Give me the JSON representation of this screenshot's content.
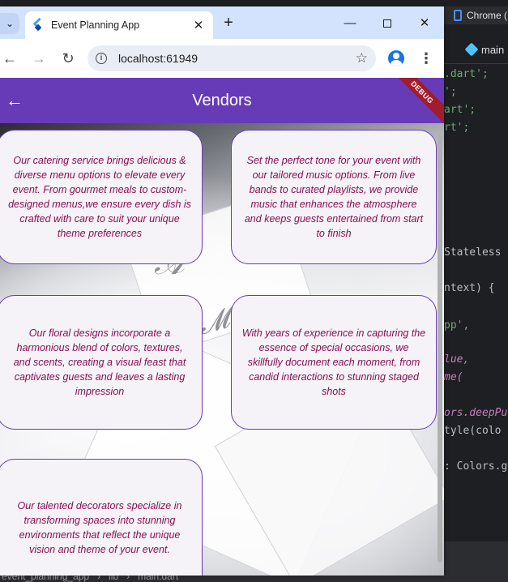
{
  "browser": {
    "tab_title": "Event Planning App",
    "tab_close": "✕",
    "new_tab": "+",
    "url": "localhost:61949",
    "tab_search_icon": "chevron-down-icon",
    "window_controls": {
      "minimize": "—",
      "close": "✕"
    },
    "nav": {
      "back": "←",
      "forward": "→",
      "reload": "↻"
    },
    "star": "☆",
    "menu": "⋮"
  },
  "app": {
    "title": "Vendors",
    "back_icon": "arrow-back-icon",
    "back_glyph": "←",
    "debug_banner": "DEBUG",
    "colors": {
      "app_bar": "#673ab7",
      "card_border": "#673ab7",
      "card_text": "#880e4f",
      "debug_banner": "#a11c2c"
    },
    "cards": [
      {
        "text": "Our catering service brings delicious & diverse menu options to elevate every event. From gourmet meals to custom-designed menus,we ensure every dish is crafted with care to suit your unique theme preferences"
      },
      {
        "text": "Set the perfect tone for your event with our tailored music options. From live bands to curated playlists, we provide music that enhances the atmosphere and keeps guests entertained from start to finish"
      },
      {
        "text": "Our floral designs incorporate a harmonious blend of colors, textures, and scents, creating a visual feast that captivates guests and leaves a lasting impression"
      },
      {
        "text": "With years of experience in capturing the essence of special occasions, we skillfully document each moment, from candid interactions to stunning staged shots"
      },
      {
        "text": "Our talented decorators specialize in transforming spaces into stunning environments that reflect the unique vision and theme of your event."
      }
    ]
  },
  "ide": {
    "chrome_tab": "Chrome (",
    "editor_tab": "main",
    "breadcrumb": [
      "event_planning_app",
      "lib",
      "main.dart"
    ],
    "code_lines": [
      ".dart';",
      "';",
      "art';",
      "rt';",
      "Stateless",
      "ntext) {",
      "pp',",
      "lue,",
      "me(",
      "ors.deepPur",
      "tyle(colo",
      ": Colors.g"
    ]
  }
}
